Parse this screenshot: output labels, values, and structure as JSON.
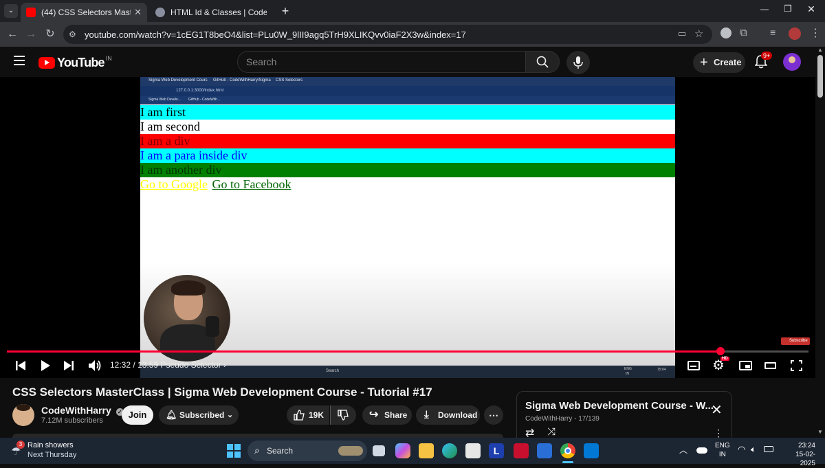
{
  "browser": {
    "tabs": [
      {
        "title": "(44) CSS Selectors MasterClass |",
        "active": true
      },
      {
        "title": "HTML Id & Classes | CodeWithH",
        "active": false
      }
    ],
    "new_tab_glyph": "+",
    "url": "youtube.com/watch?v=1cEG1T8beO4&list=PLu0W_9lII9agq5TrH9XLIKQvv0iaF2X3w&index=17",
    "window_buttons": [
      "—",
      "❐",
      "✕"
    ]
  },
  "youtube": {
    "logo_text": "YouTube",
    "country": "IN",
    "search_placeholder": "Search",
    "create_label": "Create",
    "notification_count": "9+"
  },
  "video_content": {
    "inner_tabs": [
      "Sigma Web Development Cours",
      "GitHub - CodeWithHarry/Sigma",
      "CSS Selectors"
    ],
    "inner_url": "127.0.0.1:3000/index.html",
    "inner_bookmarks": [
      "Sigma Web Develo...",
      "GitHub - CodeWith..."
    ],
    "lines": [
      {
        "text": "I am first",
        "bg": "#00ffff",
        "color": "#000000"
      },
      {
        "text": "I am second",
        "bg": "#ffffff",
        "color": "#000000"
      },
      {
        "text": "I am a div",
        "bg": "#ff0000",
        "color": "#7a0000"
      },
      {
        "text": "I am a para inside div",
        "bg": "#00ffff",
        "color": "#0000ff"
      },
      {
        "text": "I am another div",
        "bg": "#008000",
        "color": "#003300"
      }
    ],
    "links": [
      {
        "text": "Go to Google",
        "color": "#ffff00"
      },
      {
        "text": "Go to Facebook",
        "color": "#006400"
      }
    ],
    "subscribe_badge": "Subscribe",
    "inner_taskbar": {
      "search": "Search",
      "lang": "ENG",
      "region": "IN",
      "time": "15:04"
    }
  },
  "player": {
    "time": "12:32 / 13:59",
    "chapter": "Pseudo Selector",
    "progress_fraction": 0.89,
    "hd_badge": "HD",
    "progress_color": "#ff0033"
  },
  "video": {
    "title": "CSS Selectors MasterClass | Sigma Web Development Course - Tutorial #17",
    "channel": "CodeWithHarry",
    "subscribers": "7.12M subscribers",
    "join_label": "Join",
    "subscribed_label": "Subscribed",
    "likes": "19K",
    "share_label": "Share",
    "download_label": "Download"
  },
  "playlist": {
    "title": "Sigma Web Development Course - W...",
    "meta": "CodeWithHarry - 17/139"
  },
  "taskbar": {
    "weather_badge": "3",
    "weather_title": "Rain showers",
    "weather_sub": "Next Thursday",
    "search_label": "Search",
    "lang": "ENG",
    "region": "IN",
    "time": "23:24",
    "date": "15-02-2025"
  }
}
